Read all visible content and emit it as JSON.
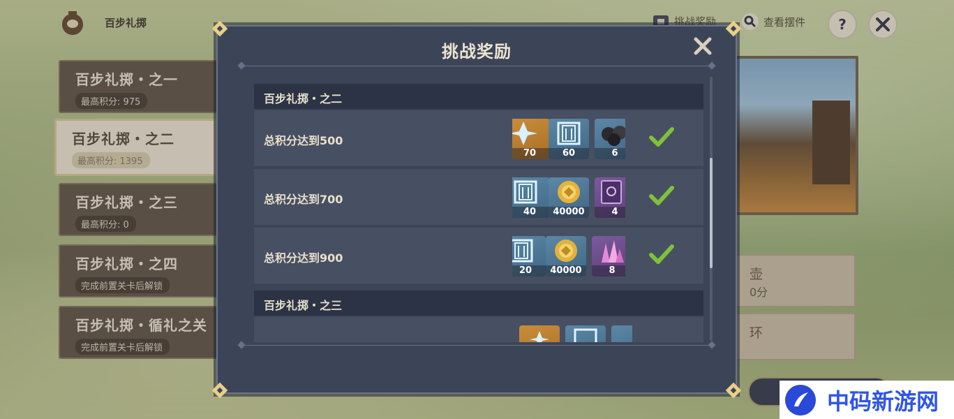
{
  "header": {
    "title": "百步礼掷",
    "challenge_rewards_label": "挑战奖励",
    "view_prop_label": "查看摆件",
    "help_label": "?"
  },
  "stages": [
    {
      "name": "百步礼掷・之一",
      "subtitle": "最高积分: 975",
      "selected": false
    },
    {
      "name": "百步礼掷・之二",
      "subtitle": "最高积分: 1395",
      "selected": true
    },
    {
      "name": "百步礼掷・之三",
      "subtitle": "最高积分: 0",
      "selected": false
    },
    {
      "name": "百步礼掷・之四",
      "subtitle": "完成前置关卡后解锁",
      "selected": false
    },
    {
      "name": "百步礼掷・循礼之关",
      "subtitle": "完成前置关卡后解锁",
      "selected": false
    }
  ],
  "right_panel": {
    "card1_text": "壶",
    "card1_sub": "0分",
    "card2_text": "环"
  },
  "modal": {
    "title": "挑战奖励",
    "groups": [
      {
        "heading": "百步礼掷・之二",
        "tasks": [
          {
            "label": "总积分达到500",
            "completed": true,
            "rewards": [
              {
                "icon": "primogem-icon",
                "count": "70",
                "bg": "orange"
              },
              {
                "icon": "hero-wit-book-icon",
                "count": "60",
                "bg": "blue"
              },
              {
                "icon": "iron-ball-icon",
                "count": "6",
                "bg": "blue"
              }
            ]
          },
          {
            "label": "总积分达到700",
            "completed": true,
            "rewards": [
              {
                "icon": "hero-wit-book-icon",
                "count": "40",
                "bg": "blue"
              },
              {
                "icon": "mora-coin-icon",
                "count": "40000",
                "bg": "blue"
              },
              {
                "icon": "purple-book-icon",
                "count": "4",
                "bg": "purple"
              }
            ]
          },
          {
            "label": "总积分达到900",
            "completed": true,
            "rewards": [
              {
                "icon": "hero-wit-book-icon",
                "count": "20",
                "bg": "blue"
              },
              {
                "icon": "mora-coin-icon",
                "count": "40000",
                "bg": "blue"
              },
              {
                "icon": "crystal-icon",
                "count": "8",
                "bg": "purple"
              }
            ]
          }
        ]
      },
      {
        "heading": "百步礼掷・之三",
        "tasks": [
          {
            "label": "",
            "completed": false,
            "rewards": [
              {
                "icon": "primogem-icon",
                "count": "",
                "bg": "orange"
              },
              {
                "icon": "hero-wit-book-icon",
                "count": "",
                "bg": "blue"
              },
              {
                "icon": "iron-ball-icon",
                "count": "",
                "bg": "blue"
              }
            ]
          }
        ]
      }
    ]
  },
  "watermark": {
    "text": "中码新游网"
  },
  "colors": {
    "accent_gold": "#e9cf8a",
    "check_green": "#7ec23a",
    "modal_bg": "#3c4458"
  }
}
